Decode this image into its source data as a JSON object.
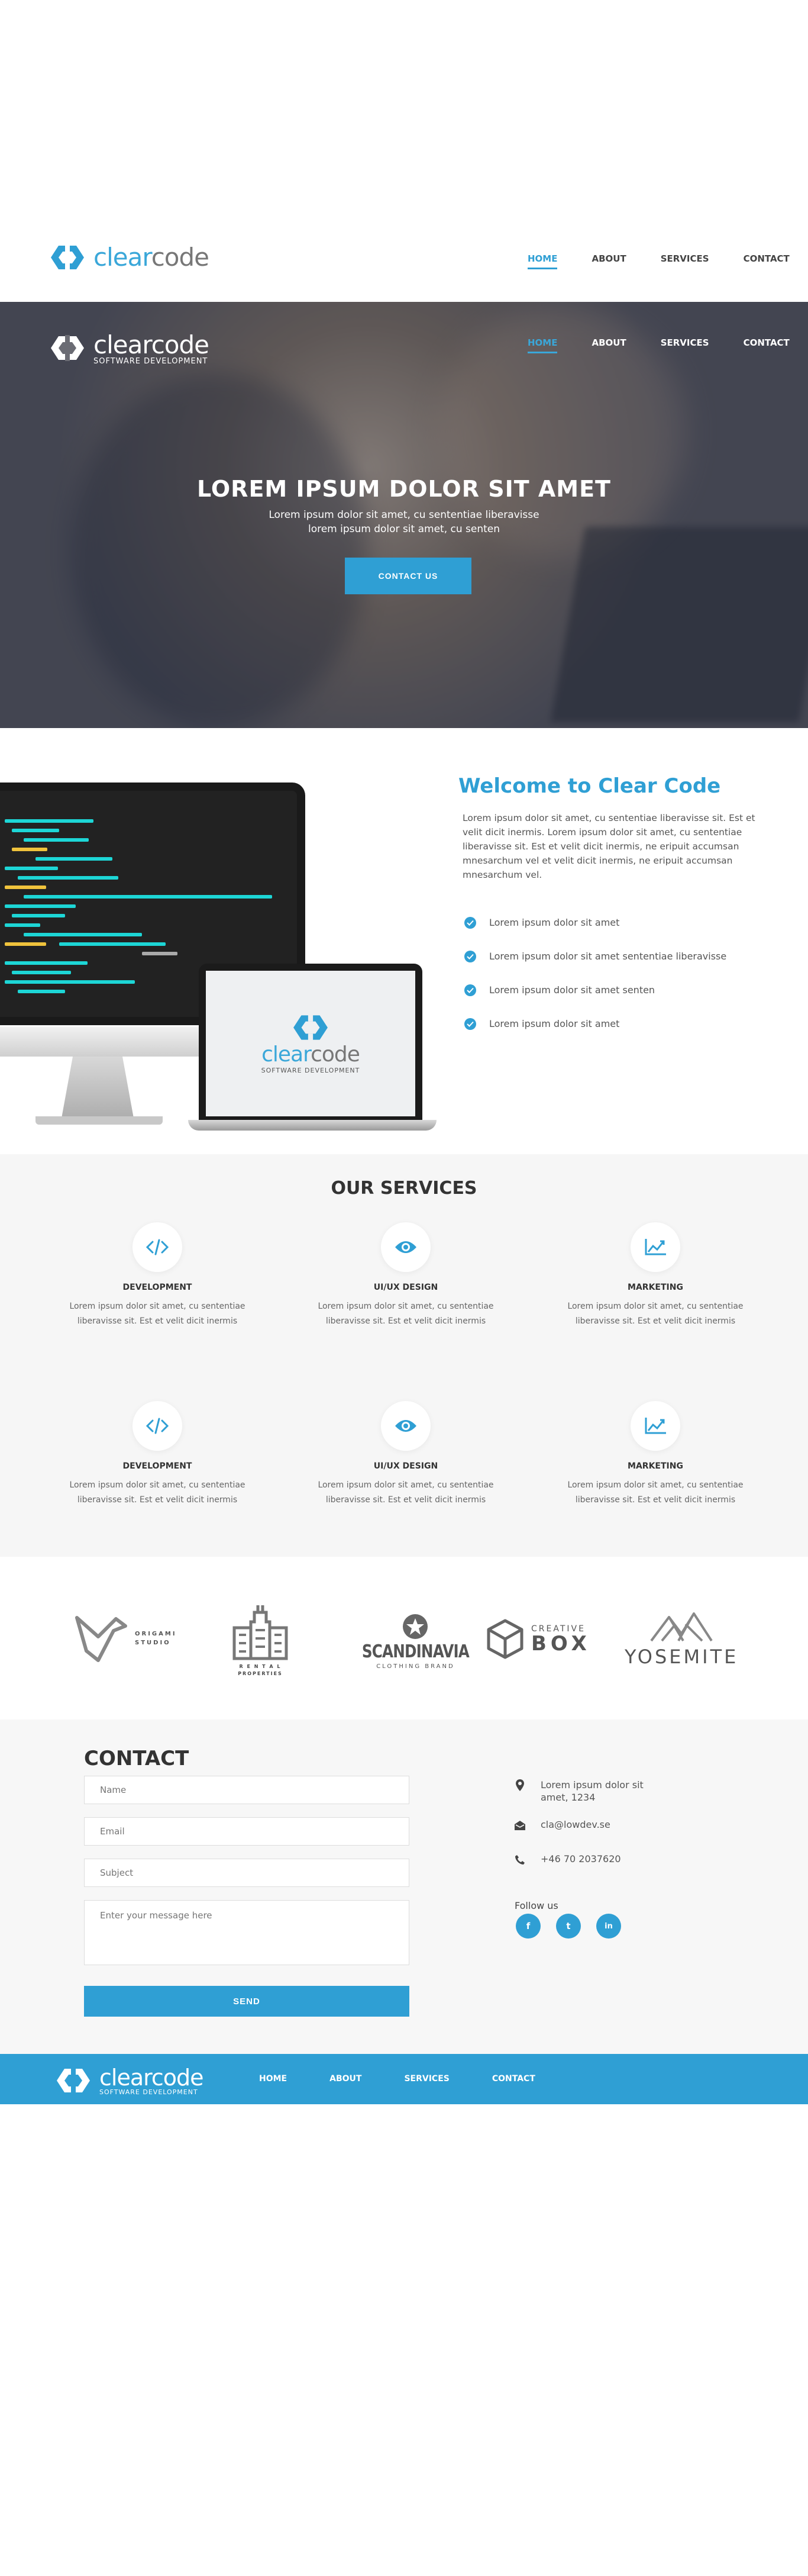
{
  "brand": {
    "clear": "clear",
    "code": "code",
    "tagline": "SOFTWARE DEVELOPMENT"
  },
  "nav": {
    "home": "HOME",
    "about": "ABOUT",
    "services": "SERVICES",
    "contact": "CONTACT"
  },
  "hero": {
    "title": "LOREM IPSUM DOLOR SIT AMET",
    "subtitle_line1": "Lorem ipsum dolor sit amet, cu sententiae liberavisse",
    "subtitle_line2": "lorem ipsum dolor sit amet, cu senten",
    "cta": "CONTACT US"
  },
  "welcome": {
    "title": "Welcome to Clear Code",
    "text": "Lorem ipsum dolor sit amet, cu sententiae liberavisse sit. Est et velit dicit inermis. Lorem ipsum dolor sit amet, cu sententiae liberavisse sit. Est et velit dicit inermis, ne eripuit accumsan mnesarchum vel et velit dicit inermis, ne eripuit accumsan mnesarchum vel.",
    "items": [
      "Lorem ipsum dolor sit amet",
      "Lorem ipsum dolor sit amet sententiae liberavisse",
      "Lorem ipsum dolor sit amet senten",
      "Lorem ipsum dolor sit amet"
    ]
  },
  "services": {
    "title": "OUR SERVICES",
    "items": [
      {
        "icon": "code-icon",
        "title": "DEVELOPMENT",
        "text": "Lorem ipsum dolor sit amet, cu sententiae liberavisse sit. Est et velit dicit inermis"
      },
      {
        "icon": "eye-icon",
        "title": "UI/UX DESIGN",
        "text": "Lorem ipsum dolor sit amet, cu sententiae liberavisse sit. Est et velit dicit inermis"
      },
      {
        "icon": "chart-icon",
        "title": "MARKETING",
        "text": "Lorem ipsum dolor sit amet, cu sententiae liberavisse sit. Est et velit dicit inermis"
      },
      {
        "icon": "code-icon",
        "title": "DEVELOPMENT",
        "text": "Lorem ipsum dolor sit amet, cu sententiae liberavisse sit. Est et velit dicit inermis"
      },
      {
        "icon": "eye-icon",
        "title": "UI/UX DESIGN",
        "text": "Lorem ipsum dolor sit amet, cu sententiae liberavisse sit. Est et velit dicit inermis"
      },
      {
        "icon": "chart-icon",
        "title": "MARKETING",
        "text": "Lorem ipsum dolor sit amet, cu sententiae liberavisse sit. Est et velit dicit inermis"
      }
    ]
  },
  "clients": {
    "origami": {
      "line1": "ORIGAMI",
      "line2": "STUDIO"
    },
    "rental": {
      "line1": "R E N T A L",
      "line2": "PROPERTIES"
    },
    "scandinavia": {
      "name": "SCANDINAVIA",
      "sub": "CLOTHING BRAND"
    },
    "creativebox": {
      "line1": "CREATIVE",
      "line2": "BOX"
    },
    "yosemite": {
      "name": "YOSEMITE"
    }
  },
  "contact": {
    "title": "CONTACT",
    "placeholders": {
      "name": "Name",
      "email": "Email",
      "subject": "Subject",
      "message": "Enter your message here"
    },
    "send": "SEND",
    "address_line1": "Lorem ipsum dolor sit",
    "address_line2": "amet, 1234",
    "email": "cla@lowdev.se",
    "phone": "+46 70 2037620",
    "follow": "Follow us",
    "social": {
      "facebook": "f",
      "twitter": "t",
      "linkedin": "in"
    }
  },
  "colors": {
    "accent": "#2f9fd4",
    "light_bg": "#f6f6f6"
  }
}
